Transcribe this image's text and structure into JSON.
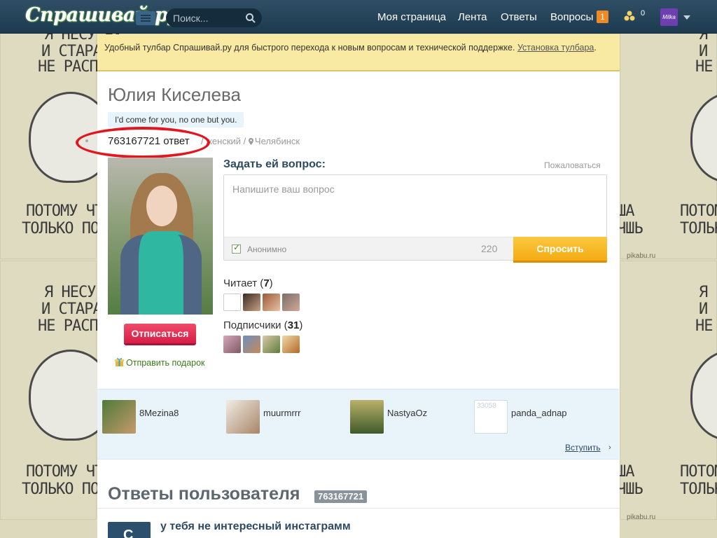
{
  "background": {
    "tile_lines_top": [
      "Я НЕСУ ЧУ",
      "И СТАРАЮС",
      "НЕ РАСПЛЕ"
    ],
    "tile_lines_bottom": [
      "ПОТОМУ ЧТО Я",
      "ТОЛЬКО ПОЛНА"
    ],
    "right_lines_top": [
      "Я",
      "И С",
      "НЕ Р"
    ],
    "right_lines_bottom": [
      "ПОТОМ",
      "ТОЛЬК"
    ],
    "mid_lines": [
      "ША",
      "ЧШЬ"
    ],
    "watermark": "pikabu.ru"
  },
  "topbar": {
    "logo": "Спрашивай.ру",
    "search_placeholder": "Поиск...",
    "nav": {
      "my_page": "Моя страница",
      "feed": "Лента",
      "answers": "Ответы",
      "questions": "Вопросы"
    },
    "questions_badge": "1",
    "coins": "0",
    "avatar_label": "Milka"
  },
  "notice": {
    "text": "Удобный тулбар Спрашивай.ру для быстрого перехода к новым вопросам и технической поддержке. ",
    "link": "Установка тулбара",
    "tail": "."
  },
  "profile": {
    "name": "Юлия Киселева",
    "status": "I'd come for you, no one but you.",
    "answers_count": "763167721 ответ",
    "gender": "женский",
    "city": "Челябинск",
    "unsubscribe": "Отписаться",
    "gift": "Отправить подарок"
  },
  "ask": {
    "title": "Задать ей вопрос:",
    "complain": "Пожаловаться",
    "placeholder": "Напишите ваш вопрос",
    "anonymous": "Анонимно",
    "counter": "220",
    "submit": "Спросить"
  },
  "following": {
    "label": "Читает",
    "count": "7"
  },
  "subscribers": {
    "label": "Подписчики",
    "count": "31"
  },
  "community": {
    "members": [
      {
        "name": "8Mezina8"
      },
      {
        "name": "muurmrrr"
      },
      {
        "name": "NastyaOz"
      },
      {
        "name": "panda_adnap",
        "photo_caption": "33058"
      }
    ],
    "join": "Вступить",
    "join_arrow": "›"
  },
  "answers_section": {
    "heading": "Ответы пользователя",
    "badge": "763167721",
    "first_question": "у тебя не интересный инстаграмм",
    "first_avatar_letter": "C"
  },
  "colors": {
    "topbar": "#1d3a4f",
    "notice": "#f9eaa3",
    "unsubscribe": "#d81d46",
    "ask_button": "#f4ab12",
    "highlight_oval": "#e2161e",
    "link_green": "#3c7c1c"
  }
}
